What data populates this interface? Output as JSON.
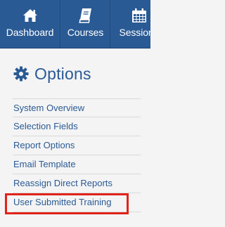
{
  "nav": {
    "tabs": [
      {
        "label": "Dashboard",
        "icon": "home-icon"
      },
      {
        "label": "Courses",
        "icon": "book-icon"
      },
      {
        "label": "Sessions",
        "icon": "calendar-icon"
      }
    ]
  },
  "options": {
    "title": "Options",
    "icon": "gear-icon",
    "items": [
      {
        "label": "System Overview"
      },
      {
        "label": "Selection Fields"
      },
      {
        "label": "Report Options"
      },
      {
        "label": "Email Template"
      },
      {
        "label": "Reassign Direct Reports"
      },
      {
        "label": "User Submitted Training",
        "highlighted": true
      }
    ]
  },
  "colors": {
    "nav_background": "#2a5a94",
    "link": "#2a5a94",
    "page_background": "#f4f4f4",
    "highlight_border": "#e2231a"
  }
}
